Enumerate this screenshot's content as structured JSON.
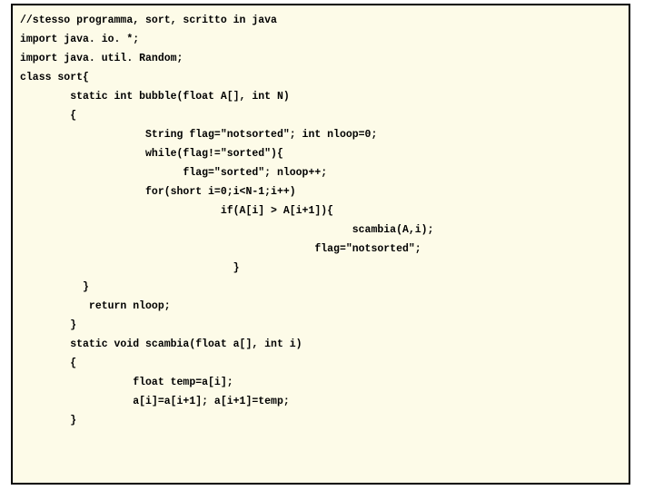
{
  "code": {
    "lines": [
      "//stesso programma, sort, scritto in java",
      "import java. io. *;",
      "import java. util. Random;",
      "class sort{",
      "        static int bubble(float A[], int N)",
      "        {",
      "                    String flag=\"notsorted\"; int nloop=0;",
      "                    while(flag!=\"sorted\"){",
      "                          flag=\"sorted\"; nloop++;",
      "                    for(short i=0;i<N-1;i++)",
      "                                if(A[i] > A[i+1]){",
      "                                                     scambia(A,i);",
      "                                               flag=\"notsorted\";",
      "                                  }",
      "          }",
      "           return nloop;",
      "        }",
      "",
      "        static void scambia(float a[], int i)",
      "        {",
      "                  float temp=a[i];",
      "                  a[i]=a[i+1]; a[i+1]=temp;",
      "        }"
    ]
  }
}
